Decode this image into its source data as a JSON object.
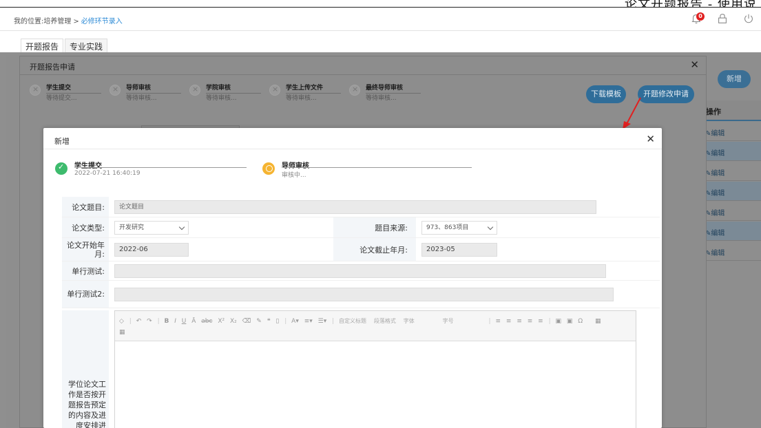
{
  "top_caption": "论文开题报告 - 使用说",
  "header": {
    "breadcrumb_prefix": "我的位置:",
    "breadcrumb_parent": "培养管理",
    "breadcrumb_sep": ">",
    "breadcrumb_current": "必修环节录入",
    "notification_count": "0"
  },
  "tabs": [
    {
      "label": "开题报告"
    },
    {
      "label": "专业实践"
    }
  ],
  "background": {
    "new_button": "新增",
    "column_header": "操作",
    "row_action": "编辑",
    "row_count": 7
  },
  "modal1": {
    "title": "开题报告申请",
    "steps": [
      {
        "name": "学生提交",
        "status": "等待提交..."
      },
      {
        "name": "导师审核",
        "status": "等待审核..."
      },
      {
        "name": "学院审核",
        "status": "等待审核..."
      },
      {
        "name": "学生上传文件",
        "status": "等待审核..."
      },
      {
        "name": "最终导师审核",
        "status": "等待审核..."
      }
    ],
    "download_button": "下载模板",
    "modify_button": "开题修改申请"
  },
  "modal2": {
    "title": "新增",
    "steps": [
      {
        "name": "学生提交",
        "status": "2022-07-21 16:40:19",
        "state": "done"
      },
      {
        "name": "导师审核",
        "status": "审核中...",
        "state": "pending"
      }
    ],
    "fields": {
      "thesis_title_label": "论文题目:",
      "thesis_title_placeholder": "论文题目",
      "thesis_type_label": "论文类型:",
      "thesis_type_value": "开发研究",
      "topic_source_label": "题目来源:",
      "topic_source_value": "973、863项目",
      "start_label": "论文开始年月:",
      "start_value": "2022-06",
      "end_label": "论文截止年月:",
      "end_value": "2023-05",
      "single_test_label": "单行测试:",
      "single_test2_label": "单行测试2:",
      "long_question_label": "学位论文工作是否按开题报告预定的内容及进度安排进"
    },
    "editor_toolbar": {
      "custom_title": "自定义标题",
      "paragraph_format": "段落格式",
      "font_family": "字体",
      "font_size": "字号"
    }
  }
}
